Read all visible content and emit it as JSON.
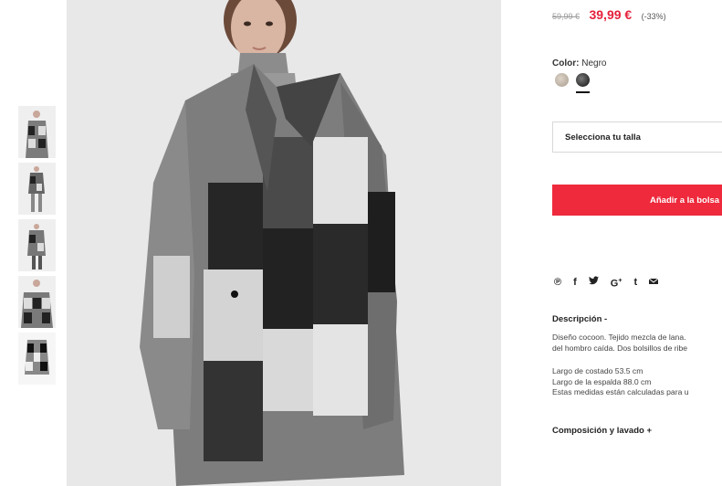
{
  "gallery": {
    "thumbnail_count": 5
  },
  "product": {
    "price_old": "59,99 €",
    "price_new": "39,99 €",
    "discount": "(-33%)",
    "color_label": "Color:",
    "color_value": "Negro",
    "swatches": [
      "beige",
      "negro"
    ],
    "size_placeholder": "Selecciona tu talla",
    "add_to_bag": "Añadir a la bolsa",
    "accent_color": "#ee2a3c"
  },
  "share": {
    "icons": [
      "pinterest-icon",
      "facebook-icon",
      "twitter-icon",
      "google-plus-icon",
      "tumblr-icon",
      "email-icon"
    ],
    "glyphs": [
      "℗",
      "f",
      "🐦",
      "G+",
      "t",
      "✉"
    ]
  },
  "description": {
    "title": "Descripción -",
    "line1": "Diseño cocoon. Tejido mezcla de lana.",
    "line2": "del hombro caída. Dos bolsillos de ribe",
    "measure1": "Largo de costado 53.5 cm",
    "measure2": "Largo de la espalda 88.0 cm",
    "measure3": "Estas medidas están calculadas para u"
  },
  "composition": {
    "title": "Composición y lavado +"
  }
}
